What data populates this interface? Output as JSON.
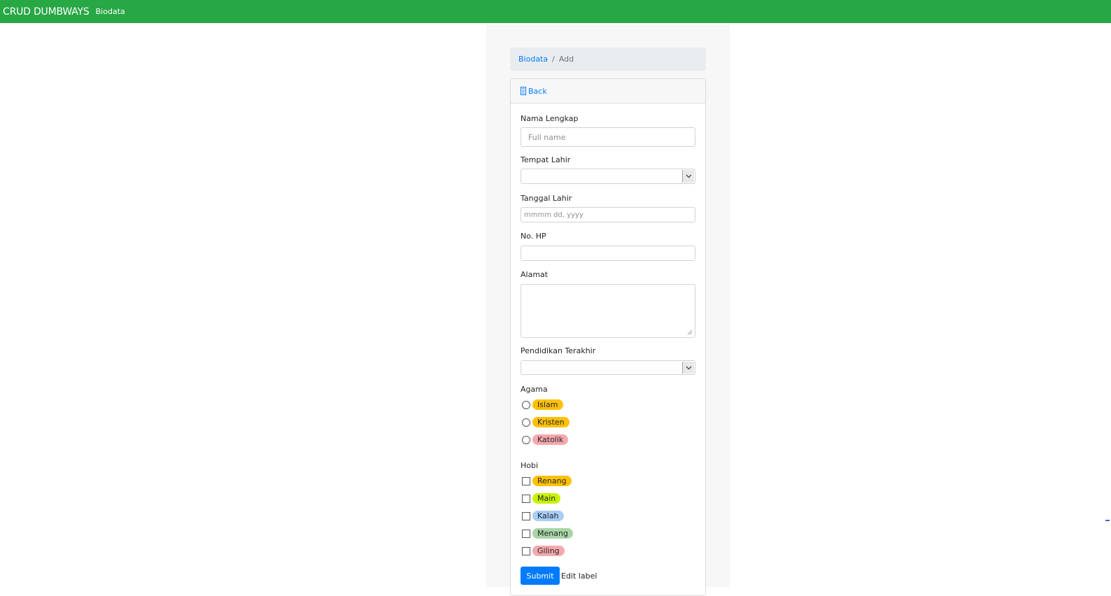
{
  "navbar": {
    "brand": "CRUD DUMBWAYS",
    "link": "Biodata",
    "color": "#28a745"
  },
  "breadcrumb": {
    "parent": "Biodata",
    "current": "Add"
  },
  "card": {
    "back_label": "Back",
    "back_icon": "document-icon"
  },
  "form": {
    "nama": {
      "label": "Nama Lengkap",
      "placeholder": "Full name"
    },
    "tempat_lahir": {
      "label": "Tempat Lahir",
      "value": ""
    },
    "tanggal_lahir": {
      "label": "Tanggal Lahir",
      "placeholder": "mmmm dd, yyyy"
    },
    "no_hp": {
      "label": "No. HP",
      "value": ""
    },
    "alamat": {
      "label": "Alamat",
      "value": ""
    },
    "pendidikan": {
      "label": "Pendidikan Terakhir",
      "value": ""
    },
    "agama": {
      "label": "Agama",
      "options": [
        {
          "label": "Islam",
          "color": "#ffc107"
        },
        {
          "label": "Kristen",
          "color": "#ffc107"
        },
        {
          "label": "Katolik",
          "color": "#f5a9ad"
        }
      ]
    },
    "hobi": {
      "label": "Hobi",
      "options": [
        {
          "label": "Renang",
          "color": "#ffc107"
        },
        {
          "label": "Main",
          "color": "#c6f400"
        },
        {
          "label": "Kalah",
          "color": "#a8cdf7"
        },
        {
          "label": "Menang",
          "color": "#a9d5a6"
        },
        {
          "label": "Giling",
          "color": "#f5a9ad"
        }
      ]
    },
    "submit_label": "Submit",
    "edit_label": "Edit label"
  }
}
